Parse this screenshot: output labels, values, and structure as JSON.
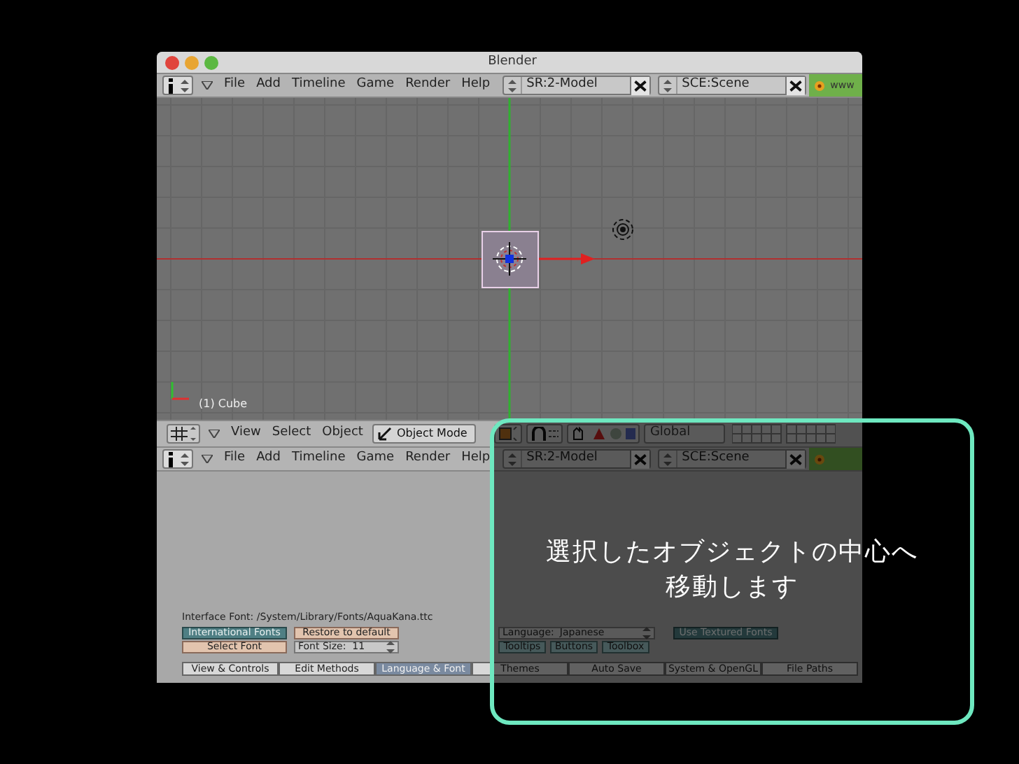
{
  "window": {
    "title": "Blender"
  },
  "top_header": {
    "menus": [
      "File",
      "Add",
      "Timeline",
      "Game",
      "Render",
      "Help"
    ],
    "screen_field": "SR:2-Model",
    "scene_field": "SCE:Scene",
    "info_text": "www"
  },
  "viewport": {
    "object_label": "(1) Cube"
  },
  "view3d_header": {
    "menus": [
      "View",
      "Select",
      "Object"
    ],
    "mode": "Object Mode",
    "orientation": "Global"
  },
  "bottom_header": {
    "menus": [
      "File",
      "Add",
      "Timeline",
      "Game",
      "Render",
      "Help"
    ],
    "screen_field": "SR:2-Model",
    "scene_field": "SCE:Scene"
  },
  "preferences": {
    "font_path": "Interface Font: /System/Library/Fonts/AquaKana.ttc",
    "international_fonts": {
      "label": "International Fonts",
      "on": true
    },
    "restore_button": "Restore to default",
    "select_font_button": "Select Font",
    "font_size": "Font Size:  11",
    "language": {
      "label": "Language:",
      "value": "Japanese"
    },
    "toggles": [
      {
        "label": "Tooltips",
        "on": true
      },
      {
        "label": "Buttons",
        "on": true
      },
      {
        "label": "Toolbox",
        "on": true
      }
    ],
    "textured_fonts": {
      "label": "Use Textured Fonts",
      "on": true
    },
    "tabs": [
      {
        "label": "View & Controls",
        "selected": false
      },
      {
        "label": "Edit Methods",
        "selected": false
      },
      {
        "label": "Language & Font",
        "selected": true
      },
      {
        "label": "Themes",
        "selected": false
      },
      {
        "label": "Auto Save",
        "selected": false
      },
      {
        "label": "System & OpenGL",
        "selected": false
      },
      {
        "label": "File Paths",
        "selected": false
      }
    ]
  },
  "callout": {
    "lines": [
      "選択したオブジェクトの中心へ",
      "移動します"
    ]
  }
}
